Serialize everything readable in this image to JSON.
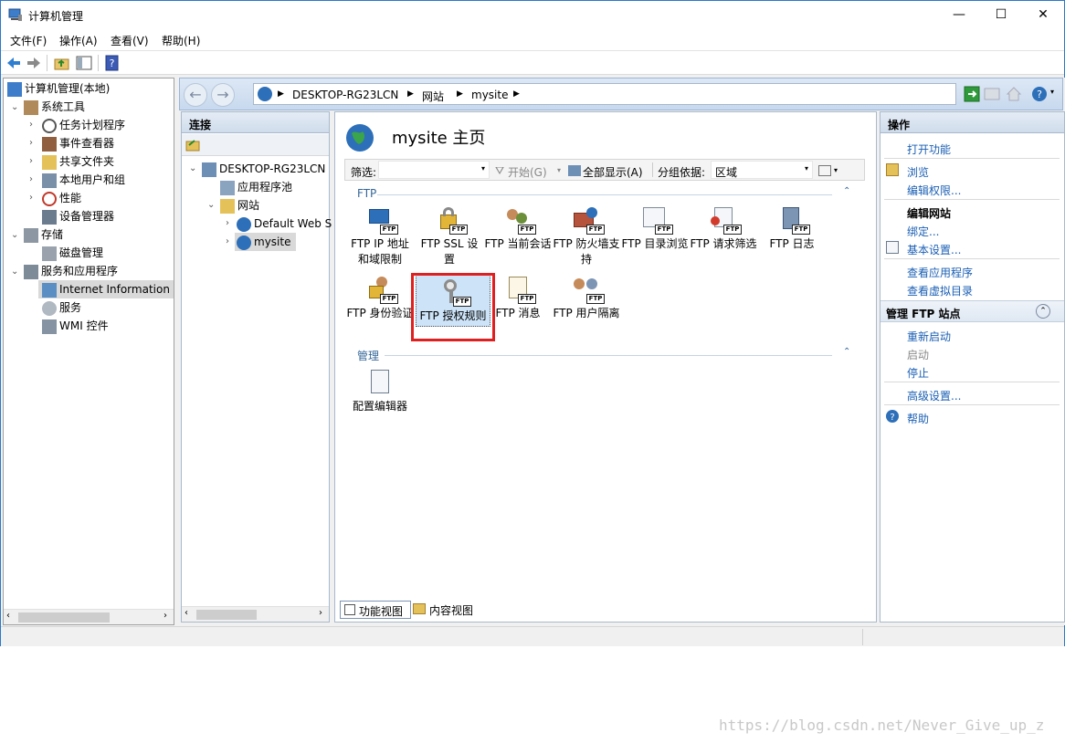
{
  "window": {
    "title": "计算机管理",
    "controls": {
      "minimize": "—",
      "maximize": "☐",
      "close": "✕"
    }
  },
  "menu": [
    "文件(F)",
    "操作(A)",
    "查看(V)",
    "帮助(H)"
  ],
  "tree": {
    "root": "计算机管理(本地)",
    "items": [
      {
        "label": "系统工具"
      },
      {
        "label": "任务计划程序"
      },
      {
        "label": "事件查看器"
      },
      {
        "label": "共享文件夹"
      },
      {
        "label": "本地用户和组"
      },
      {
        "label": "性能"
      },
      {
        "label": "设备管理器"
      },
      {
        "label": "存储"
      },
      {
        "label": "磁盘管理"
      },
      {
        "label": "服务和应用程序"
      },
      {
        "label": "Internet Information S"
      },
      {
        "label": "服务"
      },
      {
        "label": "WMI 控件"
      }
    ]
  },
  "address": {
    "parts": [
      "DESKTOP-RG23LCN",
      "网站",
      "mysite"
    ]
  },
  "connections": {
    "header": "连接",
    "items": [
      "DESKTOP-RG23LCN",
      "应用程序池",
      "网站",
      "Default Web S",
      "mysite"
    ]
  },
  "main": {
    "title": "mysite 主页",
    "filter": {
      "label": "筛选:",
      "start": "开始(G)",
      "show_all": "全部显示(A)",
      "group_by_label": "分组依据:",
      "group_by_value": "区域"
    },
    "groups": [
      {
        "name": "FTP",
        "features": [
          {
            "label": "FTP IP 地址和域限制"
          },
          {
            "label": "FTP SSL 设置"
          },
          {
            "label": "FTP 当前会话"
          },
          {
            "label": "FTP 防火墙支持"
          },
          {
            "label": "FTP 目录浏览"
          },
          {
            "label": "FTP 请求筛选"
          },
          {
            "label": "FTP 日志"
          },
          {
            "label": "FTP 身份验证"
          },
          {
            "label": "FTP 授权规则"
          },
          {
            "label": "FTP 消息"
          },
          {
            "label": "FTP 用户隔离"
          }
        ]
      },
      {
        "name": "管理",
        "features": [
          {
            "label": "配置编辑器"
          }
        ]
      }
    ],
    "badge": "FTP",
    "views": {
      "features": "功能视图",
      "content": "内容视图"
    }
  },
  "actions": {
    "header": "操作",
    "open_feature": "打开功能",
    "browse": "浏览",
    "edit_permissions": "编辑权限...",
    "edit_site": "编辑网站",
    "bindings": "绑定...",
    "basic_settings": "基本设置...",
    "view_apps": "查看应用程序",
    "view_vdirs": "查看虚拟目录",
    "manage_ftp": "管理 FTP 站点",
    "restart": "重新启动",
    "start": "启动",
    "stop": "停止",
    "advanced": "高级设置...",
    "help": "帮助"
  },
  "watermark": "https://blog.csdn.net/Never_Give_up_z"
}
